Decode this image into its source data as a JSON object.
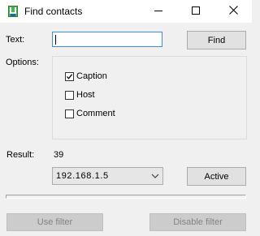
{
  "window": {
    "title": "Find contacts",
    "app_icon": "app-tag-icon",
    "controls": {
      "minimize_icon": "minimize-icon",
      "maximize_icon": "maximize-icon",
      "close_icon": "close-icon"
    }
  },
  "search": {
    "label": "Text:",
    "value": "",
    "find_label": "Find"
  },
  "options": {
    "label": "Options:",
    "items": [
      {
        "label": "Caption",
        "checked": true
      },
      {
        "label": "Host",
        "checked": false
      },
      {
        "label": "Comment",
        "checked": false
      }
    ]
  },
  "result": {
    "label": "Result:",
    "count": "39"
  },
  "filter": {
    "selected": "192.168.1.5",
    "active_label": "Active",
    "use_filter_label": "Use filter",
    "disable_filter_label": "Disable filter"
  },
  "progress": {
    "fraction": 0
  },
  "colors": {
    "background": "#f0f0f0",
    "focus_border": "#3b8fd9",
    "button_face": "#e1e1e1",
    "disabled_button_face": "#cccccc",
    "disabled_text": "#838383"
  }
}
